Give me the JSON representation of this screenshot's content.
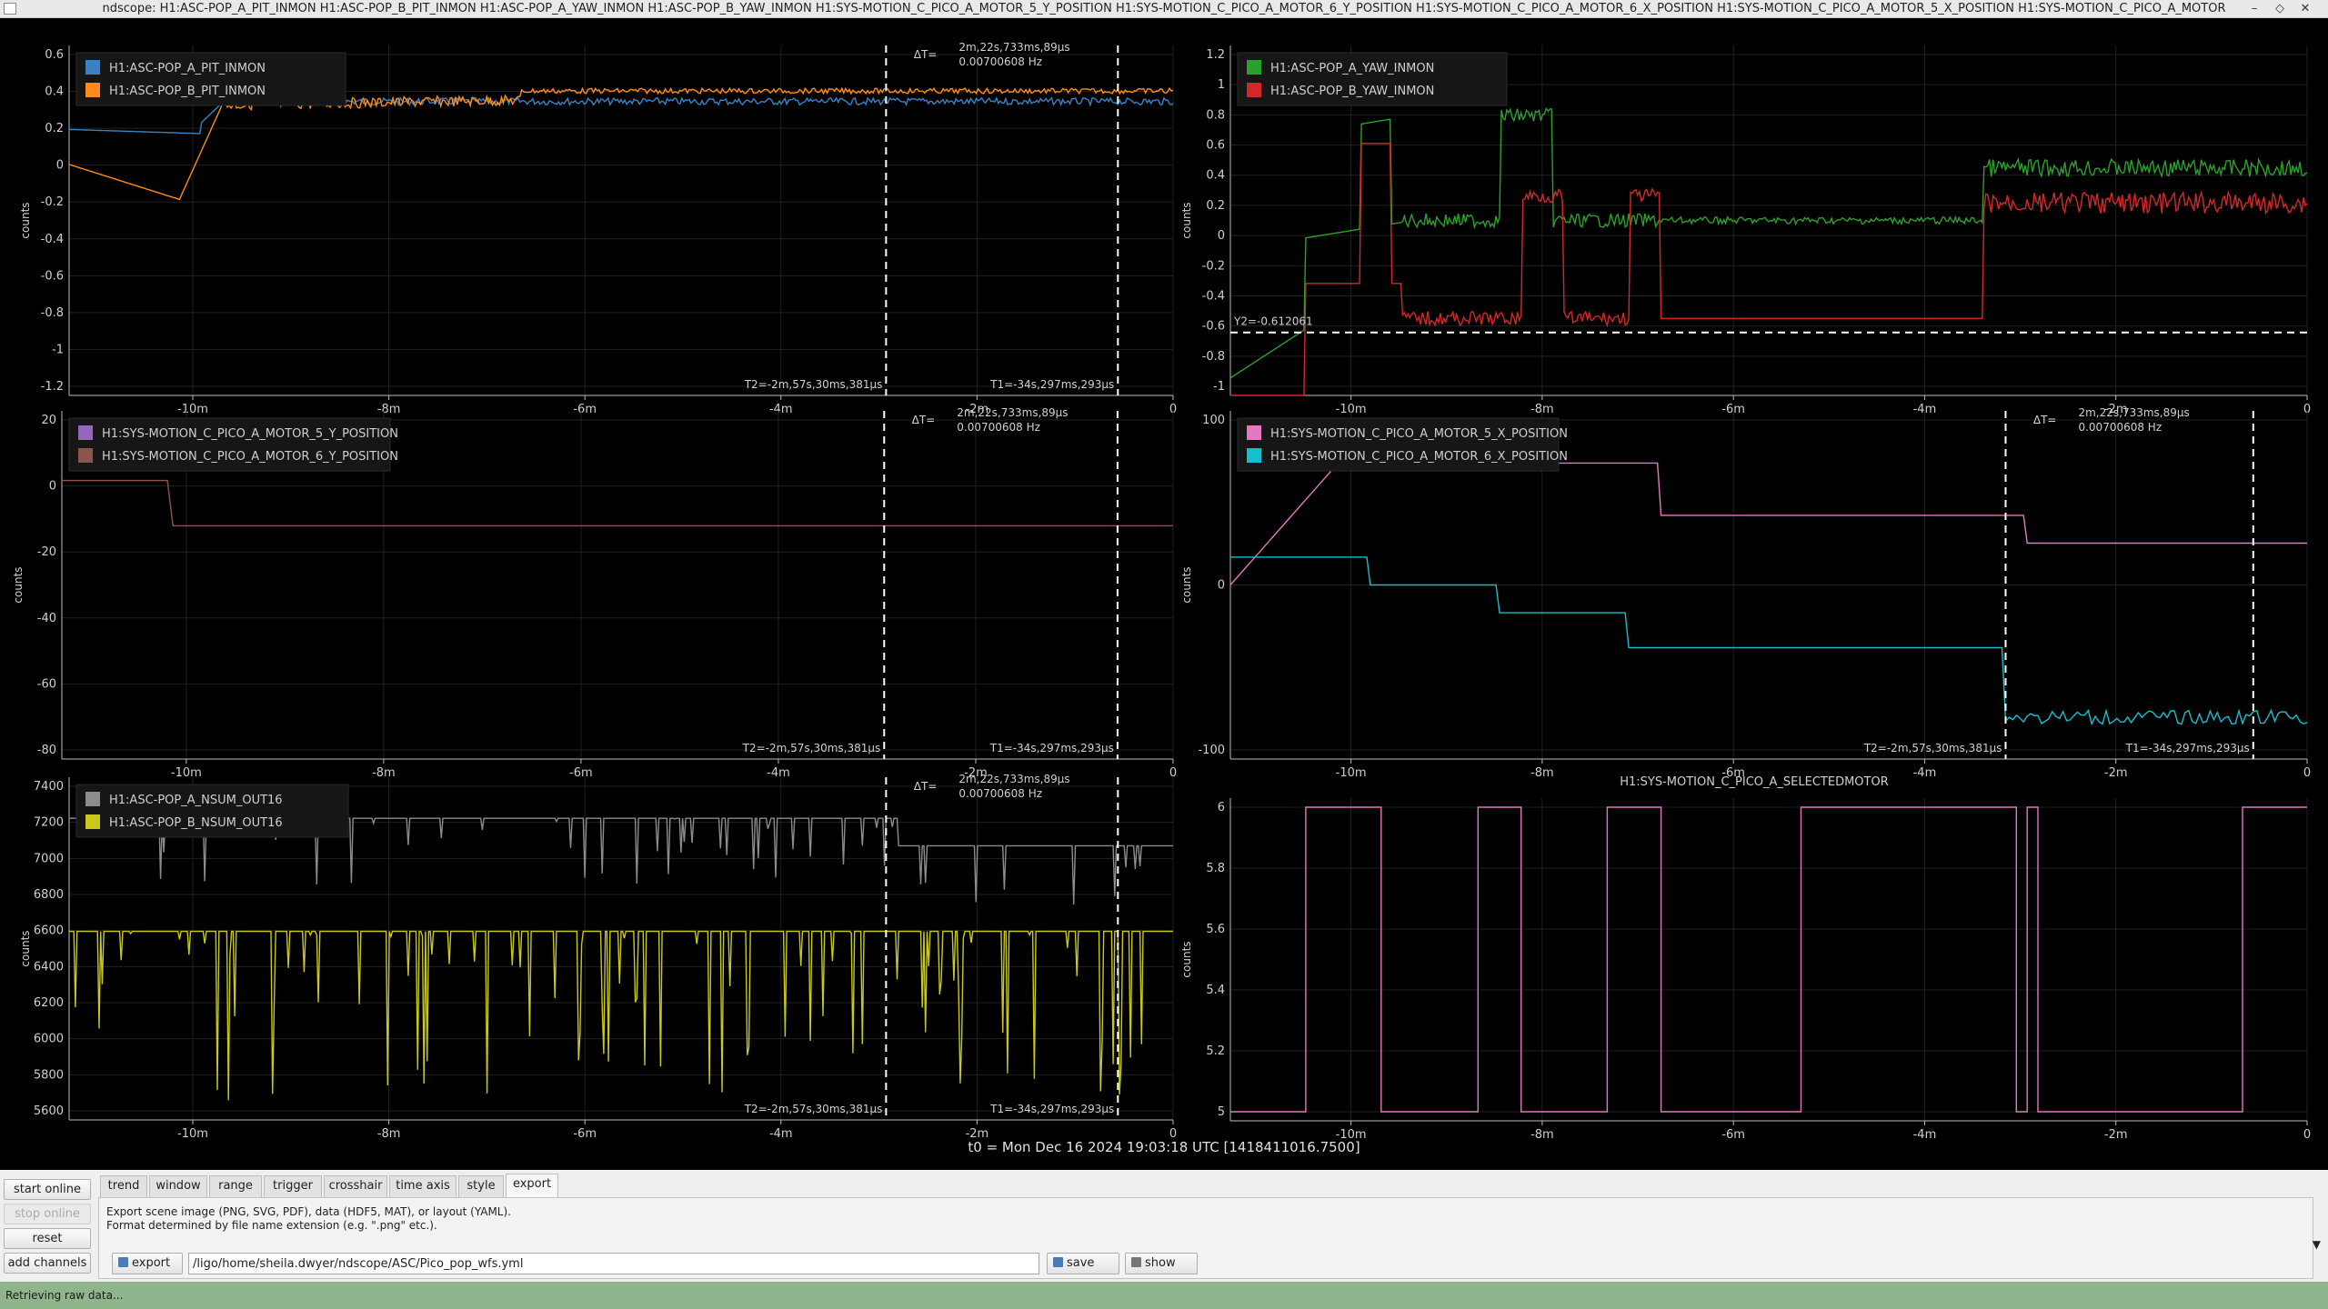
{
  "window": {
    "title": "ndscope: H1:ASC-POP_A_PIT_INMON H1:ASC-POP_B_PIT_INMON H1:ASC-POP_A_YAW_INMON H1:ASC-POP_B_YAW_INMON H1:SYS-MOTION_C_PICO_A_MOTOR_5_Y_POSITION H1:SYS-MOTION_C_PICO_A_MOTOR_6_Y_POSITION H1:SYS-MOTION_C_PICO_A_MOTOR_6_X_POSITION H1:SYS-MOTION_C_PICO_A_MOTOR_5_X_POSITION H1:SYS-MOTION_C_PICO_A_MOTOR",
    "minimize_glyph": "–",
    "maximize_glyph": "◇",
    "close_glyph": "✕"
  },
  "time_axis": {
    "ticks": [
      "-10m",
      "-8m",
      "-6m",
      "-4m",
      "-2m",
      "0"
    ],
    "t0_label": "t0 = Mon Dec 16 2024 19:03:18 UTC [1418411016.7500]"
  },
  "cursors": {
    "t2": "T2=-2m,57s,30ms,381µs",
    "t1": "T1=-34s,297ms,293µs",
    "dt": "ΔT=",
    "dt_value": "2m,22s,733ms,89µs",
    "freq": "0.00700608 Hz"
  },
  "plots": {
    "p1": {
      "ylabel": "counts",
      "yticks": [
        "0.6",
        "0.4",
        "0.2",
        "0",
        "-0.2",
        "-0.4",
        "-0.6",
        "-0.8",
        "-1",
        "-1.2"
      ],
      "legend": [
        {
          "name": "H1:ASC-POP_A_PIT_INMON",
          "color": "#3b82c4"
        },
        {
          "name": "H1:ASC-POP_B_PIT_INMON",
          "color": "#ff8c1a"
        }
      ]
    },
    "p2": {
      "ylabel": "counts",
      "yticks": [
        "1.2",
        "1",
        "0.8",
        "0.6",
        "0.4",
        "0.2",
        "0",
        "-0.2",
        "-0.4",
        "-0.6",
        "-0.8",
        "-1"
      ],
      "legend": [
        {
          "name": "H1:ASC-POP_A_YAW_INMON",
          "color": "#2ca02c"
        },
        {
          "name": "H1:ASC-POP_B_YAW_INMON",
          "color": "#d62728"
        }
      ],
      "y_cursor": "Y2=-0.612061"
    },
    "p3": {
      "ylabel": "counts",
      "yticks": [
        "20",
        "0",
        "-20",
        "-40",
        "-60",
        "-80"
      ],
      "legend": [
        {
          "name": "H1:SYS-MOTION_C_PICO_A_MOTOR_5_Y_POSITION",
          "color": "#9467bd"
        },
        {
          "name": "H1:SYS-MOTION_C_PICO_A_MOTOR_6_Y_POSITION",
          "color": "#8c564b"
        }
      ]
    },
    "p4": {
      "ylabel": "counts",
      "yticks": [
        "100",
        "0",
        "-100"
      ],
      "legend": [
        {
          "name": "H1:SYS-MOTION_C_PICO_A_MOTOR_5_X_POSITION",
          "color": "#e377c2"
        },
        {
          "name": "H1:SYS-MOTION_C_PICO_A_MOTOR_6_X_POSITION",
          "color": "#17becf"
        }
      ]
    },
    "p5": {
      "ylabel": "counts",
      "yticks": [
        "7400",
        "7200",
        "7000",
        "6800",
        "6600",
        "6400",
        "6200",
        "6000",
        "5800",
        "5600"
      ],
      "legend": [
        {
          "name": "H1:ASC-POP_A_NSUM_OUT16",
          "color": "#8c8c8c"
        },
        {
          "name": "H1:ASC-POP_B_NSUM_OUT16",
          "color": "#c8c81e"
        }
      ]
    },
    "p6": {
      "title": "H1:SYS-MOTION_C_PICO_A_SELECTEDMOTOR",
      "ylabel": "counts",
      "yticks": [
        "6",
        "5.8",
        "5.6",
        "5.4",
        "5.2",
        "5"
      ],
      "line_color": "#e377c2"
    }
  },
  "controls": {
    "start_online": "start online",
    "stop_online": "stop online",
    "reset": "reset",
    "add_channels": "add channels",
    "tabs": [
      "trend",
      "window",
      "range",
      "trigger",
      "crosshair",
      "time axis",
      "style",
      "export"
    ],
    "active_tab": "export",
    "export_desc_1": "Export scene image (PNG, SVG, PDF), data (HDF5, MAT), or layout (YAML).",
    "export_desc_2": "Format determined by file name extension (e.g. \".png\" etc.).",
    "export_button": "export",
    "export_path": "/ligo/home/sheila.dwyer/ndscope/ASC/Pico_pop_wfs.yml",
    "save_button": "save",
    "show_button": "show",
    "collapse_glyph": "▼"
  },
  "status": {
    "text": "Retrieving raw data..."
  }
}
